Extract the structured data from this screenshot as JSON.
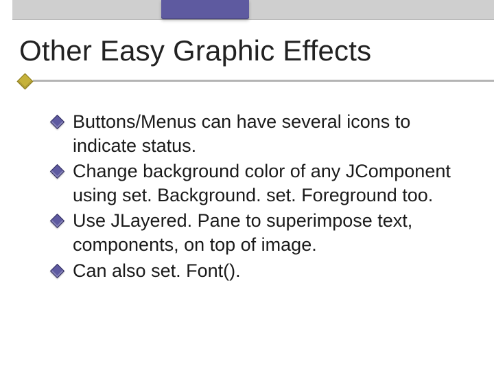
{
  "title": "Other Easy Graphic Effects",
  "bullets": [
    "Buttons/Menus can have several icons to indicate status.",
    "Change background color of any JComponent using set. Background. set. Foreground too.",
    "Use JLayered. Pane to superimpose text, components, on top of image.",
    "Can also set. Font()."
  ]
}
